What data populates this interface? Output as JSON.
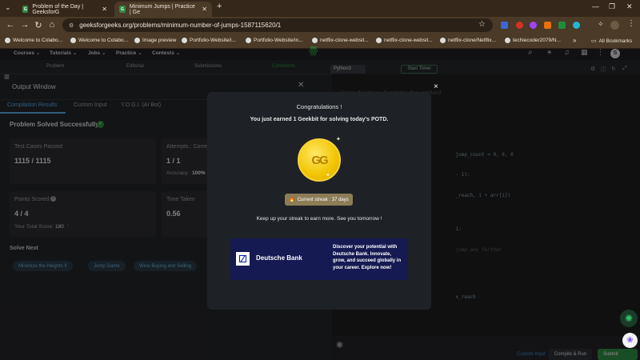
{
  "browser": {
    "tabs": [
      {
        "title": "Problem of the Day | GeeksforG",
        "fav": "gfg"
      },
      {
        "title": "Minimum Jumps | Practice | Ge",
        "fav": "gfg"
      }
    ],
    "new_tab": "+",
    "url": "geeksforgeeks.org/problems/minimum-number-of-jumps-1587115620/1",
    "bookmarks": [
      "Welcome to Colabo...",
      "Welcome to Colabo...",
      "Image preview",
      "Portfolio-Website/i...",
      "Portfolio-Website/in...",
      "netflix-clone-websit...",
      "netflix-clone-websit...",
      "netflix-clone/Netflix...",
      "techiecoder2079/N..."
    ],
    "all_bookmarks": "All Bookmarks",
    "more": "»"
  },
  "gfg_nav": {
    "items": [
      "Courses ⌄",
      "Tutorials ⌄",
      "Jobs ⌄",
      "Practice ⌄",
      "Contests ⌄"
    ],
    "avatar": "S"
  },
  "subnav": {
    "items": [
      "Problem",
      "Editorial",
      "Submissions",
      "Comments"
    ]
  },
  "output_window": {
    "title": "Output Window",
    "tabs": [
      "Compilation Results",
      "Custom Input",
      "Y.O.G.I. (AI Bot)"
    ],
    "status": "Problem Solved Successfully",
    "test_cases_label": "Test Cases Passed",
    "test_cases_value": "1115 / 1115",
    "attempts_label": "Attempts : Corre",
    "attempts_value": "1 / 1",
    "accuracy_label": "Accuracy :",
    "accuracy_value": "100%",
    "points_label": "Points Scored",
    "points_value": "4 / 4",
    "total_score_label": "Your Total Score:",
    "total_score_value": "180",
    "time_label": "Time Taken",
    "time_value": "0.56",
    "solve_next": "Solve Next",
    "next_chips": [
      "Minimize the Heights II",
      "Jump Game",
      "Wine Buying and Selling"
    ]
  },
  "editor": {
    "language": "Python3",
    "start_timer": "Start Timer",
    "code_lines": [
      "#User function Template for python3",
      "class Solution:",
      "    def minJumps(self, arr):",
      "                                        jump_count = 0, 0, 0",
      "                                        - 1):",
      "                                        _reach, i + arr[i])",
      "",
      "                                        1:",
      "                                        jump any further",
      "",
      "",
      "                                        x_reach"
    ],
    "line_numbers": [
      "1",
      "2",
      "3",
      "4",
      "5",
      "6",
      "7",
      "8",
      "9",
      "10",
      "11",
      "12"
    ],
    "custom_input": "Custom Input",
    "compile_run": "Compile & Run",
    "submit": "Submit"
  },
  "modal": {
    "title": "Congratulations !",
    "subtitle": "You just earned 1 Geekbit for solving today's POTD.",
    "coin_logo": "GG",
    "streak": "Current streak : 37 days",
    "keep": "Keep up your streak to earn more. See you tomorrow !",
    "ad_brand": "Deutsche Bank",
    "ad_text": "Discover your potential with Deutsche Bank. Innovate, grow, and succeed globally in your career. Explore now!",
    "close": "×"
  },
  "colors": {
    "gfg_green": "#2f8d46",
    "success": "#2f8d46",
    "streak_bg": "#8c7d57",
    "ad_bg": "#151a52"
  }
}
